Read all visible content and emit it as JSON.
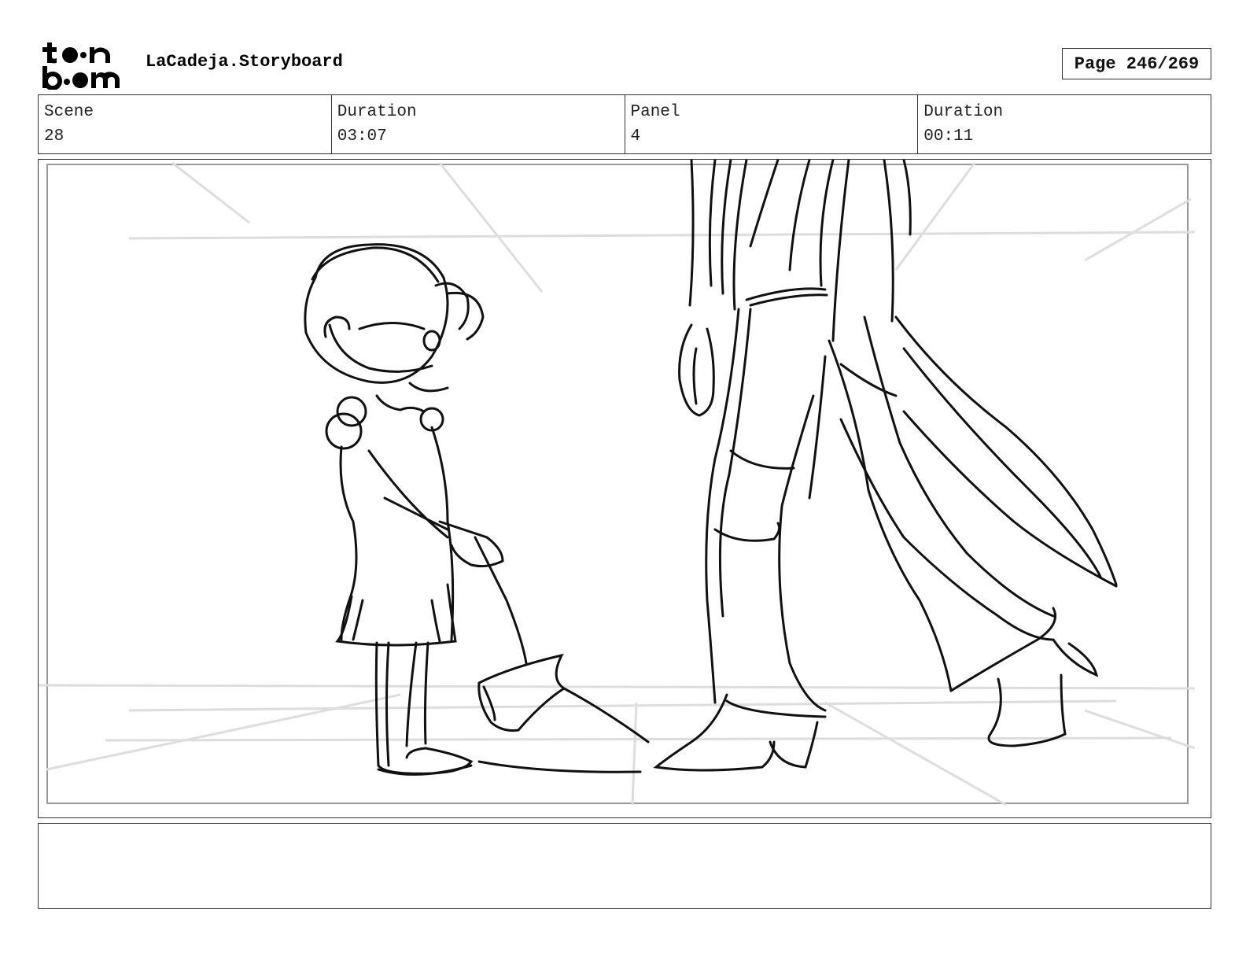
{
  "logo": {
    "line1": "toon",
    "line2": "boom",
    "icon": "toon-boom-logo"
  },
  "document": {
    "title": "LaCadeja.Storyboard"
  },
  "page": {
    "label": "Page 246/269"
  },
  "info": {
    "scene_label": "Scene",
    "scene_value": "28",
    "scene_duration_label": "Duration",
    "scene_duration_value": "03:07",
    "panel_label": "Panel",
    "panel_value": "4",
    "panel_duration_label": "Duration",
    "panel_duration_value": "00:11"
  },
  "notes": {
    "text": ""
  }
}
